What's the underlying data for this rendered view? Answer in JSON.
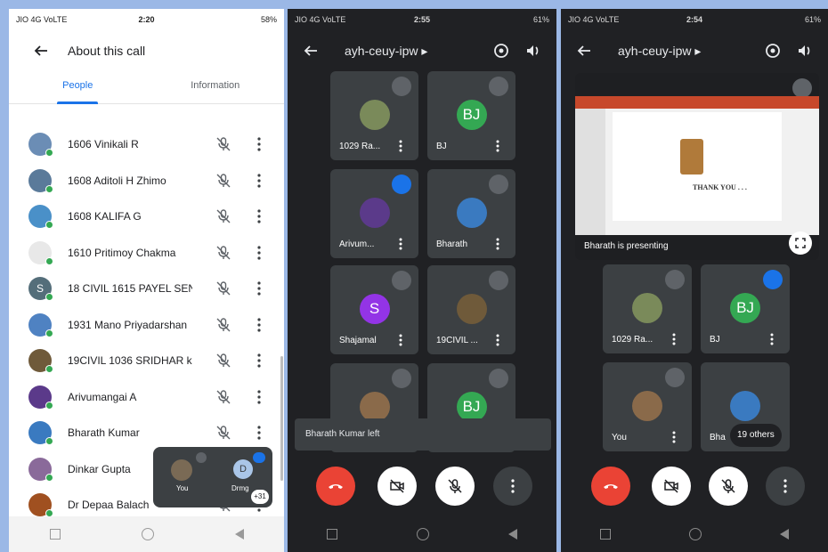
{
  "phone1": {
    "status": {
      "carrier": "JIO 4G VoLTE",
      "time": "2:20",
      "battery": "58%"
    },
    "title": "About this call",
    "tabs": [
      "People",
      "Information"
    ],
    "participants": [
      {
        "name": "1606 Vinikali R",
        "color": "#6b8db5"
      },
      {
        "name": "1608 Aditoli H Zhimo",
        "color": "#5a7a9a"
      },
      {
        "name": "1608 KALIFA G",
        "color": "#4a90c8"
      },
      {
        "name": "1610 Pritimoy Chakma",
        "color": "#e8e8e8"
      },
      {
        "name": "18 CIVIL 1615 PAYEL SEN",
        "color": "#546e7a",
        "letter": "S"
      },
      {
        "name": "1931 Mano Priyadarshan",
        "color": "#4f82c2"
      },
      {
        "name": "19CIVIL 1036 SRIDHAR k",
        "color": "#6f5a3a"
      },
      {
        "name": "Arivumangai A",
        "color": "#5b3a8a"
      },
      {
        "name": "Bharath Kumar",
        "color": "#3a7ac0"
      },
      {
        "name": "Dinkar Gupta",
        "color": "#8a6a9a"
      },
      {
        "name": "Dr Depaa Balach",
        "color": "#a05020"
      }
    ],
    "mini": {
      "you": "You",
      "other": "Drmg",
      "other_letter": "D",
      "count": "+31"
    }
  },
  "phone2": {
    "status": {
      "carrier": "JIO 4G VoLTE",
      "time": "2:55",
      "battery": "61%"
    },
    "meeting_code": "ayh-ceuy-ipw",
    "tiles": [
      {
        "name": "1029 Ra...",
        "state": "muted",
        "color": "#7a8a5a"
      },
      {
        "name": "BJ",
        "state": "muted",
        "color": "#34a853",
        "letter": "BJ"
      },
      {
        "name": "Arivum...",
        "state": "speaking",
        "color": "#5b3a8a"
      },
      {
        "name": "Bharath",
        "state": "muted",
        "color": "#3a7ac0"
      },
      {
        "name": "Shajamal",
        "state": "muted",
        "color": "#9334e6",
        "letter": "S"
      },
      {
        "name": "19CIVIL ...",
        "state": "muted",
        "color": "#6f5a3a"
      },
      {
        "name": "",
        "state": "muted",
        "color": "#8a6a4a"
      },
      {
        "name": "",
        "state": "muted",
        "color": "#34a853",
        "letter": "BJ"
      }
    ],
    "toast": "Bharath Kumar left"
  },
  "phone3": {
    "status": {
      "carrier": "JIO 4G VoLTE",
      "time": "2:54",
      "battery": "61%"
    },
    "meeting_code": "ayh-ceuy-ipw",
    "presenting": "Bharath is presenting",
    "slide_text": "THANK YOU . . .",
    "tiles": [
      {
        "name": "1029 Ra...",
        "state": "muted",
        "color": "#7a8a5a"
      },
      {
        "name": "BJ",
        "state": "speaking",
        "color": "#34a853",
        "letter": "BJ"
      },
      {
        "name": "You",
        "state": "muted",
        "color": "#8a6a4a"
      },
      {
        "name": "Bha",
        "state": "none",
        "color": "#3a7ac0"
      }
    ],
    "others": "19 others"
  }
}
